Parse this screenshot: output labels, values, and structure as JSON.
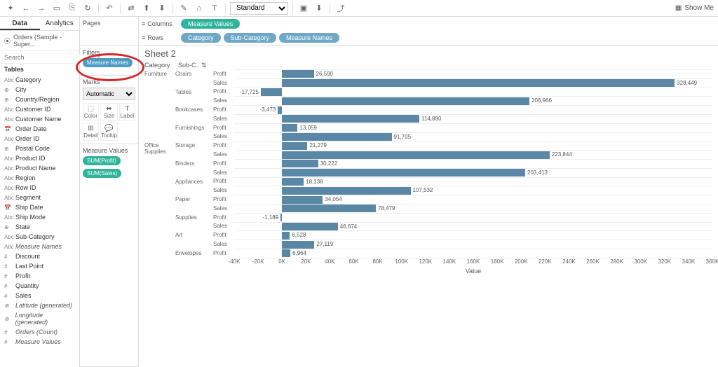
{
  "toolbar": {
    "fit": "Standard",
    "show_me": "Show Me"
  },
  "data_panel": {
    "tabs": [
      "Data",
      "Analytics"
    ],
    "source": "Orders (Sample - Super...",
    "search_placeholder": "Search",
    "tables_label": "Tables",
    "fields": [
      {
        "icon": "Abc",
        "name": "Category"
      },
      {
        "icon": "⊕",
        "name": "City"
      },
      {
        "icon": "⊕",
        "name": "Country/Region"
      },
      {
        "icon": "Abc",
        "name": "Customer ID"
      },
      {
        "icon": "Abc",
        "name": "Customer Name"
      },
      {
        "icon": "📅",
        "name": "Order Date"
      },
      {
        "icon": "Abc",
        "name": "Order ID"
      },
      {
        "icon": "⊕",
        "name": "Postal Code"
      },
      {
        "icon": "Abc",
        "name": "Product ID"
      },
      {
        "icon": "Abc",
        "name": "Product Name"
      },
      {
        "icon": "Abc",
        "name": "Region"
      },
      {
        "icon": "Abc",
        "name": "Row ID"
      },
      {
        "icon": "Abc",
        "name": "Segment"
      },
      {
        "icon": "📅",
        "name": "Ship Date"
      },
      {
        "icon": "Abc",
        "name": "Ship Mode"
      },
      {
        "icon": "⊕",
        "name": "State"
      },
      {
        "icon": "Abc",
        "name": "Sub-Category"
      },
      {
        "icon": "Abc",
        "name": "Measure Names",
        "italic": true
      },
      {
        "icon": "#",
        "name": "Discount"
      },
      {
        "icon": "#",
        "name": "Last Point"
      },
      {
        "icon": "#",
        "name": "Profit"
      },
      {
        "icon": "#",
        "name": "Quantity"
      },
      {
        "icon": "#",
        "name": "Sales"
      },
      {
        "icon": "⊕",
        "name": "Latitude (generated)",
        "italic": true
      },
      {
        "icon": "⊕",
        "name": "Longitude (generated)",
        "italic": true
      },
      {
        "icon": "#",
        "name": "Orders (Count)",
        "italic": true
      },
      {
        "icon": "#",
        "name": "Measure Values",
        "italic": true
      }
    ]
  },
  "cards": {
    "pages": "Pages",
    "filters": "Filters",
    "filter_pill": "Measure Names",
    "marks": "Marks",
    "marks_type": "Automatic",
    "marks_cells": [
      "Color",
      "Size",
      "Label",
      "Detail",
      "Tooltip"
    ],
    "measure_values": "Measure Values",
    "mv_pills": [
      "SUM(Profit)",
      "SUM(Sales)"
    ]
  },
  "shelves": {
    "columns": "Columns",
    "rows": "Rows",
    "col_pills": [
      "Measure Values"
    ],
    "row_pills": [
      "Category",
      "Sub-Category",
      "Measure Names"
    ]
  },
  "sheet": {
    "title": "Sheet 2",
    "cat_hdr": "Category",
    "sub_hdr": "Sub-C..",
    "axis_title": "Value"
  },
  "chart_data": {
    "type": "bar",
    "xlabel": "Value",
    "xlim": [
      -40000,
      360000
    ],
    "ticks": [
      "-40K",
      "-20K",
      "0K",
      "20K",
      "40K",
      "60K",
      "80K",
      "100K",
      "120K",
      "140K",
      "160K",
      "180K",
      "200K",
      "220K",
      "240K",
      "260K",
      "280K",
      "300K",
      "320K",
      "340K",
      "360K"
    ],
    "groups": [
      {
        "category": "Furniture",
        "subs": [
          {
            "sub": "Chairs",
            "rows": [
              {
                "m": "Profit",
                "v": 26590,
                "label": "26,590"
              },
              {
                "m": "Sales",
                "v": 328449,
                "label": "328,449"
              }
            ]
          },
          {
            "sub": "Tables",
            "rows": [
              {
                "m": "Profit",
                "v": -17725,
                "label": "-17,725"
              },
              {
                "m": "Sales",
                "v": 206966,
                "label": "206,966"
              }
            ]
          },
          {
            "sub": "Bookcases",
            "rows": [
              {
                "m": "Profit",
                "v": -3473,
                "label": "-3,473"
              },
              {
                "m": "Sales",
                "v": 114880,
                "label": "114,880"
              }
            ]
          },
          {
            "sub": "Furnishings",
            "rows": [
              {
                "m": "Profit",
                "v": 13059,
                "label": "13,059"
              },
              {
                "m": "Sales",
                "v": 91705,
                "label": "91,705"
              }
            ]
          }
        ]
      },
      {
        "category": "Office Supplies",
        "subs": [
          {
            "sub": "Storage",
            "rows": [
              {
                "m": "Profit",
                "v": 21279,
                "label": "21,279"
              },
              {
                "m": "Sales",
                "v": 223844,
                "label": "223,844"
              }
            ]
          },
          {
            "sub": "Binders",
            "rows": [
              {
                "m": "Profit",
                "v": 30222,
                "label": "30,222"
              },
              {
                "m": "Sales",
                "v": 203413,
                "label": "203,413"
              }
            ]
          },
          {
            "sub": "Appliances",
            "rows": [
              {
                "m": "Profit",
                "v": 18138,
                "label": "18,138"
              },
              {
                "m": "Sales",
                "v": 107532,
                "label": "107,532"
              }
            ]
          },
          {
            "sub": "Paper",
            "rows": [
              {
                "m": "Profit",
                "v": 34054,
                "label": "34,054"
              },
              {
                "m": "Sales",
                "v": 78479,
                "label": "78,479"
              }
            ]
          },
          {
            "sub": "Supplies",
            "rows": [
              {
                "m": "Profit",
                "v": -1189,
                "label": "-1,189"
              },
              {
                "m": "Sales",
                "v": 46674,
                "label": "46,674"
              }
            ]
          },
          {
            "sub": "Art",
            "rows": [
              {
                "m": "Profit",
                "v": 6528,
                "label": "6,528"
              },
              {
                "m": "Sales",
                "v": 27119,
                "label": "27,119"
              }
            ]
          },
          {
            "sub": "Envelopes",
            "rows": [
              {
                "m": "Profit",
                "v": 6964,
                "label": "6,964"
              }
            ]
          }
        ]
      }
    ]
  }
}
